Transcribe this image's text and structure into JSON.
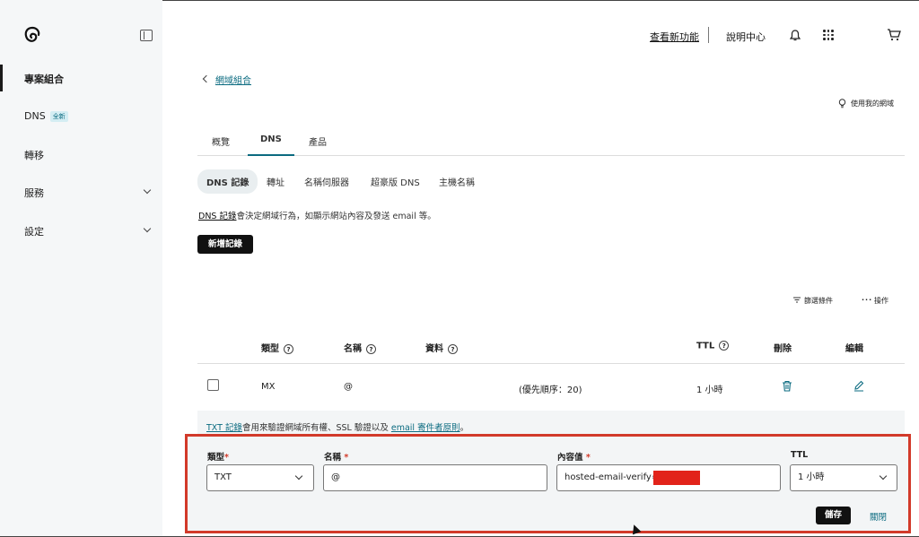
{
  "sidebar": {
    "items": [
      {
        "label": "專案組合"
      },
      {
        "label": "DNS",
        "badge": "全新"
      },
      {
        "label": "轉移"
      },
      {
        "label": "服務"
      },
      {
        "label": "設定"
      }
    ]
  },
  "header": {
    "whats_new": "查看新功能",
    "help_center": "說明中心"
  },
  "breadcrumb": {
    "back_label": "網域組合"
  },
  "use_my_domain": "使用我的網域",
  "tabs": [
    {
      "label": "概覽"
    },
    {
      "label": "DNS"
    },
    {
      "label": "產品"
    }
  ],
  "subtabs": [
    {
      "label": "DNS 記錄"
    },
    {
      "label": "轉址"
    },
    {
      "label": "名稱伺服器"
    },
    {
      "label": "超豪版 DNS"
    },
    {
      "label": "主機名稱"
    }
  ],
  "description": {
    "link": "DNS 記錄",
    "text": "會決定網域行為，如顯示網站內容及發送 email 等。"
  },
  "add_record_button": "新增記錄",
  "toolbar": {
    "filter": "篩選條件",
    "actions": "操作"
  },
  "table": {
    "headers": {
      "type": "類型",
      "name": "名稱",
      "data": "資料",
      "ttl": "TTL",
      "delete": "刪除",
      "edit": "編輯"
    },
    "rows": [
      {
        "type": "MX",
        "name": "@",
        "data": "(優先順序：20)",
        "ttl": "1 小時"
      }
    ]
  },
  "txt_info": {
    "link1": "TXT 記錄",
    "text1": "會用來驗證網域所有權、SSL 驗證以及",
    "link2": "email 寄件者原則",
    "text2": "。"
  },
  "form": {
    "type_label": "類型",
    "type_value": "TXT",
    "name_label": "名稱",
    "name_value": "@",
    "value_label": "內容值",
    "value_value": "hosted-email-verify=",
    "ttl_label": "TTL",
    "ttl_value": "1 小時",
    "required_mark": "*",
    "save_label": "儲存",
    "close_label": "關閉"
  },
  "colors": {
    "accent": "#0b6b80",
    "highlight_border": "#d23a2a",
    "redaction": "#e2231a"
  }
}
